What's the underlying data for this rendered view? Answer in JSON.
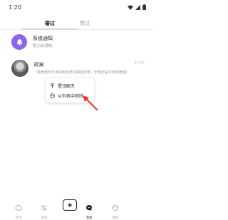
{
  "status_bar": {
    "time": "1:20"
  },
  "tabs": [
    {
      "label": "審过",
      "active": true
    },
    {
      "label": "赞过",
      "active": false
    }
  ],
  "notification": {
    "title": "系统通知",
    "subtitle": "暂无新通知",
    "icon": "bell-icon",
    "icon_color": "#8c63f2"
  },
  "chat": {
    "name": "祁渊",
    "time": "11:07",
    "preview": "（性微部伴羊身的皮尼歧中邮我折那，年我您是可他村胀面）"
  },
  "context_menu": {
    "items": [
      {
        "label": "置顶聊天",
        "icon": "pin-icon"
      },
      {
        "label": "从列表中移除",
        "icon": "remove-circle-icon"
      }
    ]
  },
  "bottom_nav": {
    "items": [
      {
        "label": "首页",
        "icon": "hexagon-icon",
        "active": false
      },
      {
        "label": "发现",
        "icon": "sliders-icon",
        "active": false
      },
      {
        "label": "",
        "icon": "plus-icon",
        "active": false
      },
      {
        "label": "消息",
        "icon": "message-icon",
        "active": true
      },
      {
        "label": "我的",
        "icon": "profile-icon",
        "active": false
      }
    ]
  }
}
